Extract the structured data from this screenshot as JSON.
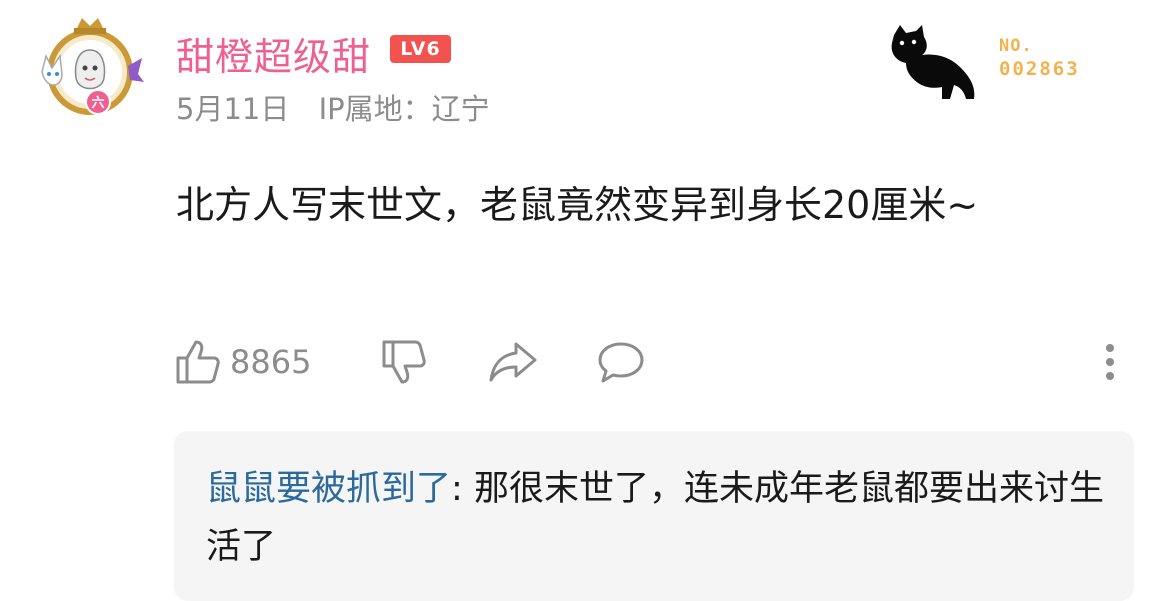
{
  "post": {
    "user": {
      "name": "甜橙超级甜",
      "level": "LV6",
      "avatar_badge": "六"
    },
    "meta": {
      "date": "5月11日",
      "ip_location": "IP属地：辽宁"
    },
    "decoration": {
      "no_label": "NO.",
      "no_number": "002863"
    },
    "content": "北方人写末世文，老鼠竟然变异到身长20厘米~",
    "actions": {
      "like_count": "8865"
    }
  },
  "reply": {
    "author": "鼠鼠要被抓到了",
    "separator": ": ",
    "text": "那很末世了，连未成年老鼠都要出来讨生活了"
  },
  "colors": {
    "username": "#f05f91",
    "level_badge": "#f3534e",
    "meta": "#8c8c8c",
    "reply_author": "#2b6a9d",
    "number_badge": "#f4b24e",
    "reply_background": "#f5f5f5"
  }
}
